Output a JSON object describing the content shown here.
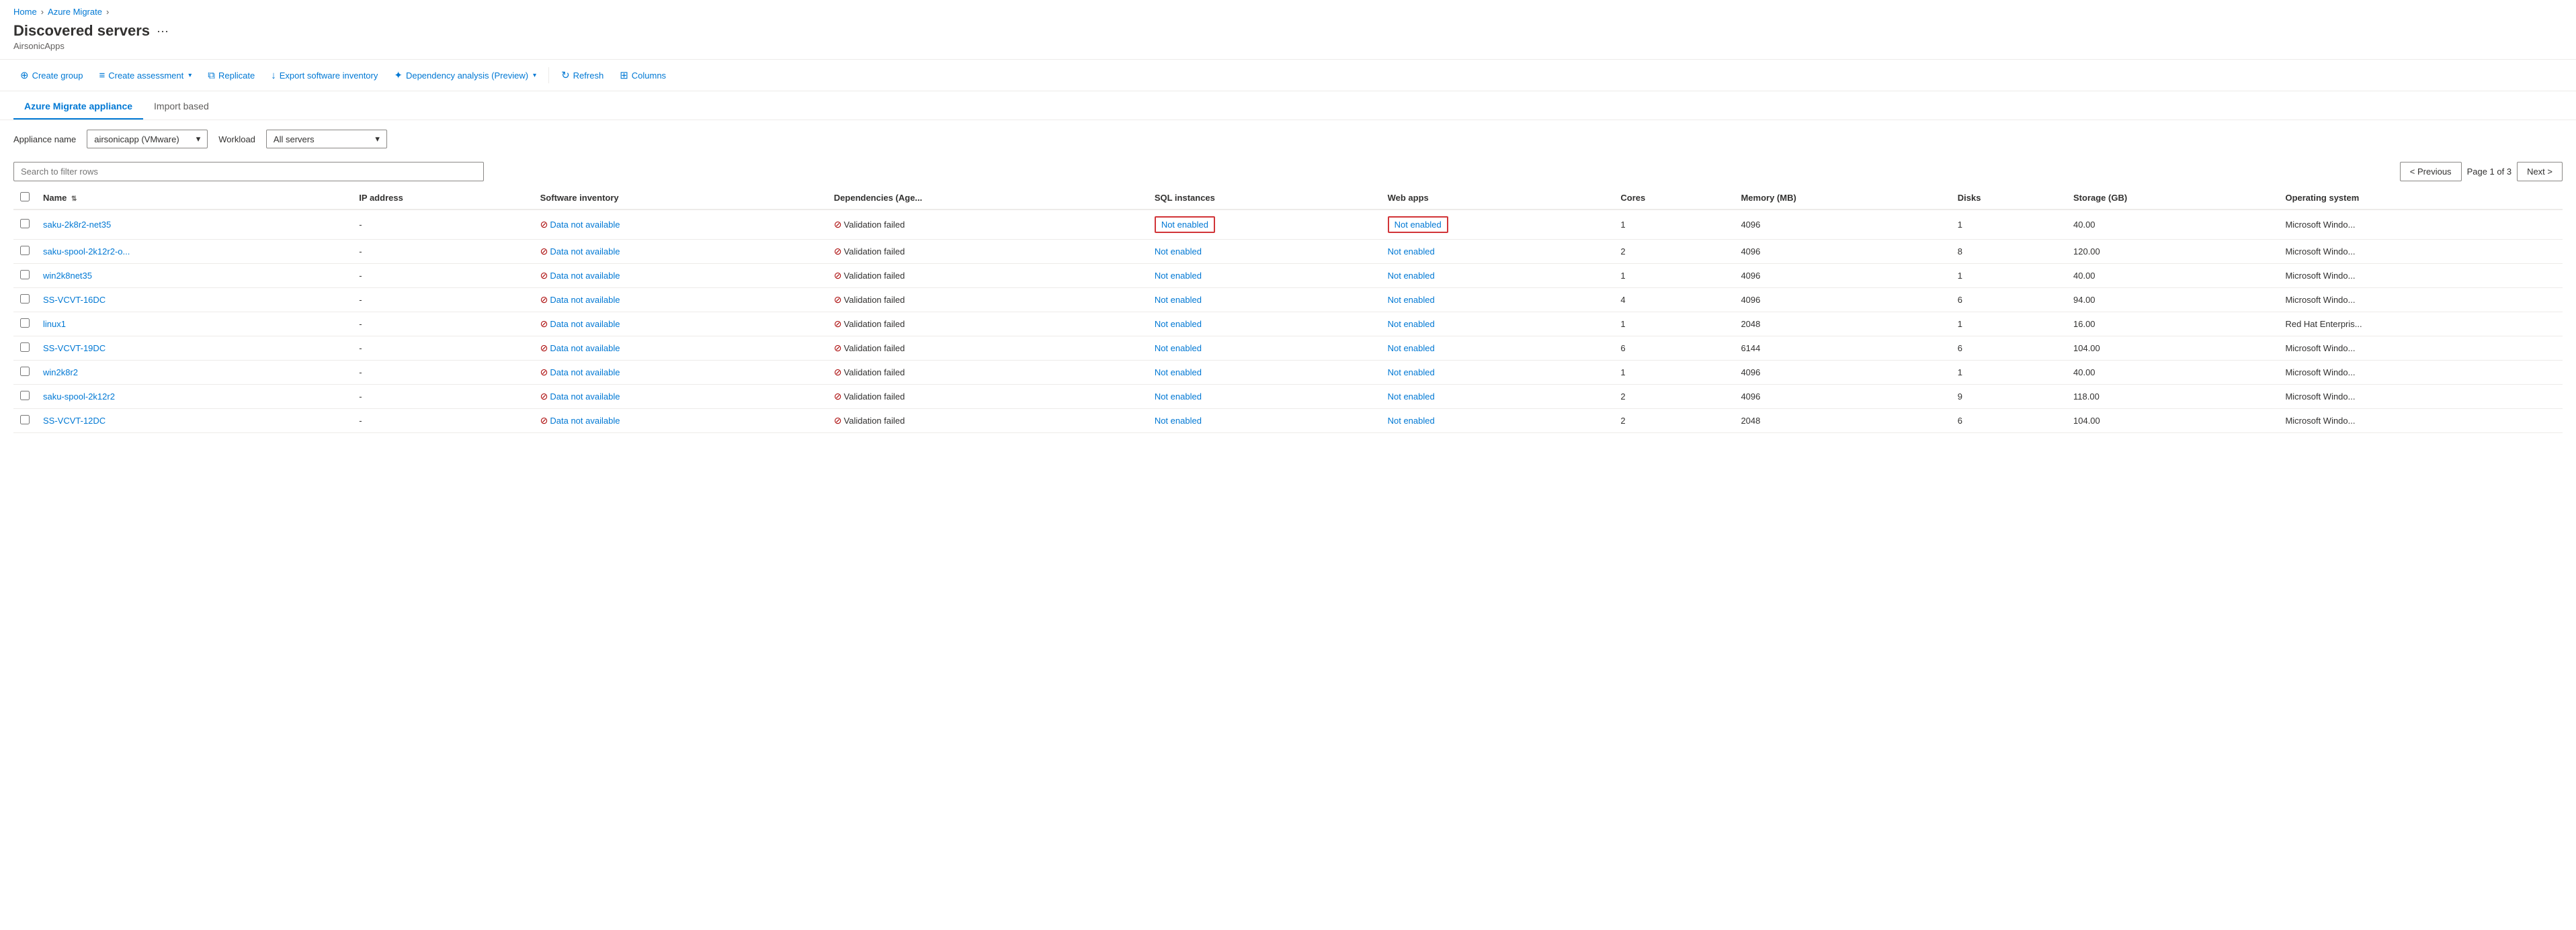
{
  "breadcrumb": {
    "home": "Home",
    "parent": "Azure Migrate",
    "separator": ">"
  },
  "page": {
    "title": "Discovered servers",
    "subtitle": "AirsonicApps",
    "more_icon": "···"
  },
  "toolbar": {
    "create_group": "Create group",
    "create_assessment": "Create assessment",
    "replicate": "Replicate",
    "export": "Export software inventory",
    "dependency_analysis": "Dependency analysis (Preview)",
    "refresh": "Refresh",
    "columns": "Columns"
  },
  "tabs": [
    {
      "label": "Azure Migrate appliance",
      "active": true
    },
    {
      "label": "Import based",
      "active": false
    }
  ],
  "filters": {
    "appliance_label": "Appliance name",
    "appliance_value": "airsonicapp (VMware)",
    "workload_label": "Workload",
    "workload_value": "All servers"
  },
  "search": {
    "placeholder": "Search to filter rows"
  },
  "pagination": {
    "previous": "< Previous",
    "next": "Next >",
    "page_info": "Page 1 of 3"
  },
  "table": {
    "columns": [
      {
        "key": "name",
        "label": "Name"
      },
      {
        "key": "ip",
        "label": "IP address"
      },
      {
        "key": "software_inventory",
        "label": "Software inventory"
      },
      {
        "key": "dependencies",
        "label": "Dependencies (Age..."
      },
      {
        "key": "sql_instances",
        "label": "SQL instances"
      },
      {
        "key": "web_apps",
        "label": "Web apps"
      },
      {
        "key": "cores",
        "label": "Cores"
      },
      {
        "key": "memory",
        "label": "Memory (MB)"
      },
      {
        "key": "disks",
        "label": "Disks"
      },
      {
        "key": "storage",
        "label": "Storage (GB)"
      },
      {
        "key": "os",
        "label": "Operating system"
      }
    ],
    "rows": [
      {
        "name": "saku-2k8r2-net35",
        "ip": "-",
        "software_inventory": "Data not available",
        "dependencies": "Validation failed",
        "sql_instances": "Not enabled",
        "web_apps": "Not enabled",
        "cores": "1",
        "memory": "4096",
        "disks": "1",
        "storage": "40.00",
        "os": "Microsoft Windo...",
        "highlight_sql": true,
        "highlight_web": true
      },
      {
        "name": "saku-spool-2k12r2-o...",
        "ip": "-",
        "software_inventory": "Data not available",
        "dependencies": "Validation failed",
        "sql_instances": "Not enabled",
        "web_apps": "Not enabled",
        "cores": "2",
        "memory": "4096",
        "disks": "8",
        "storage": "120.00",
        "os": "Microsoft Windo...",
        "highlight_sql": false,
        "highlight_web": false
      },
      {
        "name": "win2k8net35",
        "ip": "-",
        "software_inventory": "Data not available",
        "dependencies": "Validation failed",
        "sql_instances": "Not enabled",
        "web_apps": "Not enabled",
        "cores": "1",
        "memory": "4096",
        "disks": "1",
        "storage": "40.00",
        "os": "Microsoft Windo...",
        "highlight_sql": false,
        "highlight_web": false
      },
      {
        "name": "SS-VCVT-16DC",
        "ip": "-",
        "software_inventory": "Data not available",
        "dependencies": "Validation failed",
        "sql_instances": "Not enabled",
        "web_apps": "Not enabled",
        "cores": "4",
        "memory": "4096",
        "disks": "6",
        "storage": "94.00",
        "os": "Microsoft Windo...",
        "highlight_sql": false,
        "highlight_web": false
      },
      {
        "name": "linux1",
        "ip": "-",
        "software_inventory": "Data not available",
        "dependencies": "Validation failed",
        "sql_instances": "Not enabled",
        "web_apps": "Not enabled",
        "cores": "1",
        "memory": "2048",
        "disks": "1",
        "storage": "16.00",
        "os": "Red Hat Enterpris...",
        "highlight_sql": false,
        "highlight_web": false
      },
      {
        "name": "SS-VCVT-19DC",
        "ip": "-",
        "software_inventory": "Data not available",
        "dependencies": "Validation failed",
        "sql_instances": "Not enabled",
        "web_apps": "Not enabled",
        "cores": "6",
        "memory": "6144",
        "disks": "6",
        "storage": "104.00",
        "os": "Microsoft Windo...",
        "highlight_sql": false,
        "highlight_web": false
      },
      {
        "name": "win2k8r2",
        "ip": "-",
        "software_inventory": "Data not available",
        "dependencies": "Validation failed",
        "sql_instances": "Not enabled",
        "web_apps": "Not enabled",
        "cores": "1",
        "memory": "4096",
        "disks": "1",
        "storage": "40.00",
        "os": "Microsoft Windo...",
        "highlight_sql": false,
        "highlight_web": false
      },
      {
        "name": "saku-spool-2k12r2",
        "ip": "-",
        "software_inventory": "Data not available",
        "dependencies": "Validation failed",
        "sql_instances": "Not enabled",
        "web_apps": "Not enabled",
        "cores": "2",
        "memory": "4096",
        "disks": "9",
        "storage": "118.00",
        "os": "Microsoft Windo...",
        "highlight_sql": false,
        "highlight_web": false
      },
      {
        "name": "SS-VCVT-12DC",
        "ip": "-",
        "software_inventory": "Data not available",
        "dependencies": "Validation failed",
        "sql_instances": "Not enabled",
        "web_apps": "Not enabled",
        "cores": "2",
        "memory": "2048",
        "disks": "6",
        "storage": "104.00",
        "os": "Microsoft Windo...",
        "highlight_sql": false,
        "highlight_web": false
      }
    ]
  },
  "colors": {
    "accent": "#0078d4",
    "error": "#a80000",
    "border": "#edebe9",
    "highlight_border": "#d13438"
  }
}
